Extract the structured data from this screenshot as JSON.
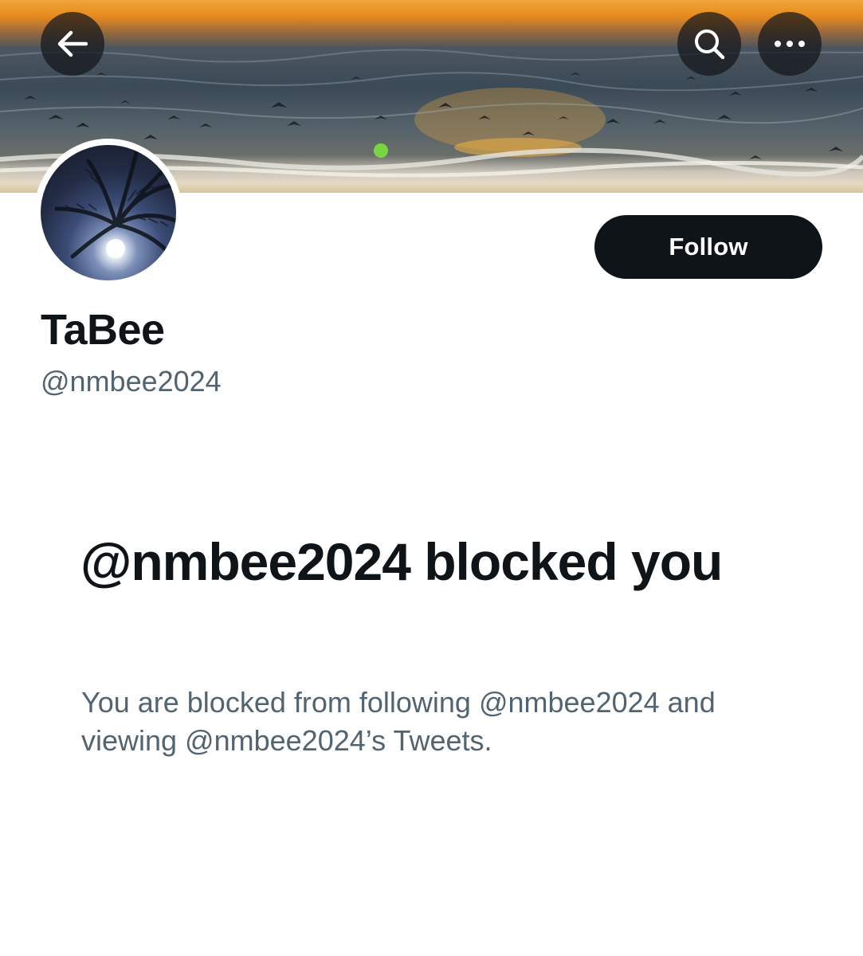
{
  "header": {
    "back_icon": "arrow-left-icon",
    "search_icon": "search-icon",
    "more_icon": "more-horizontal-icon"
  },
  "profile": {
    "display_name": "TaBee",
    "handle": "@nmbee2024",
    "follow_label": "Follow"
  },
  "blocked_notice": {
    "title": "@nmbee2024 blocked you",
    "description": "You are blocked from following @nmbee2024 and viewing @nmbee2024’s Tweets."
  },
  "colors": {
    "primary_text": "#0f1419",
    "secondary_text": "#536471",
    "follow_button_bg": "#0f1419"
  }
}
